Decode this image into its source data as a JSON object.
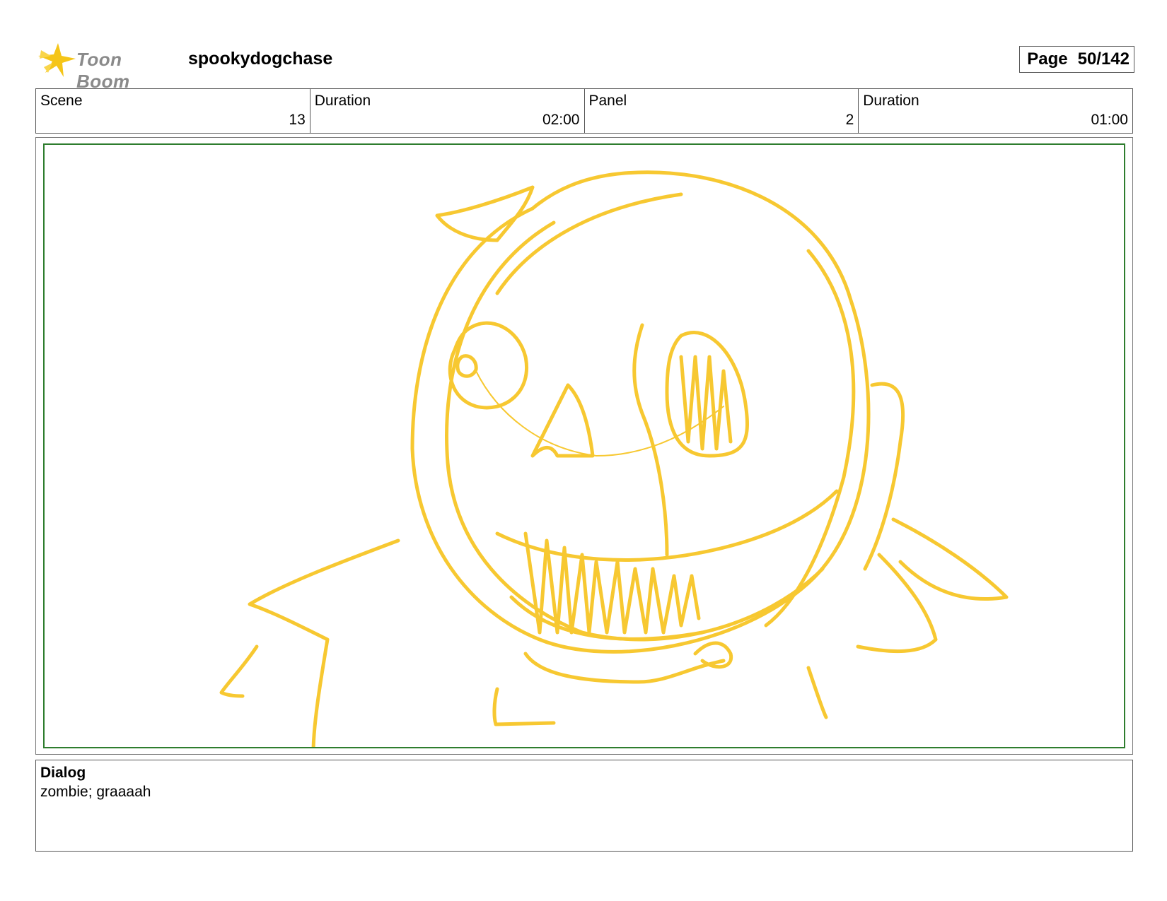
{
  "header": {
    "logo_text": "Toon Boom",
    "project_title": "spookydogchase",
    "page_label": "Page",
    "page_value": "50/142"
  },
  "info": {
    "scene_label": "Scene",
    "scene_value": "13",
    "scene_duration_label": "Duration",
    "scene_duration_value": "02:00",
    "panel_label": "Panel",
    "panel_value": "2",
    "panel_duration_label": "Duration",
    "panel_duration_value": "01:00"
  },
  "dialog": {
    "label": "Dialog",
    "text": "zombie; graaaah"
  },
  "colors": {
    "sketch_stroke": "#f7c831",
    "frame_border": "#2e7d2e",
    "logo_star": "#f5c518"
  },
  "icons": {
    "logo": "toon-boom-star-icon"
  }
}
